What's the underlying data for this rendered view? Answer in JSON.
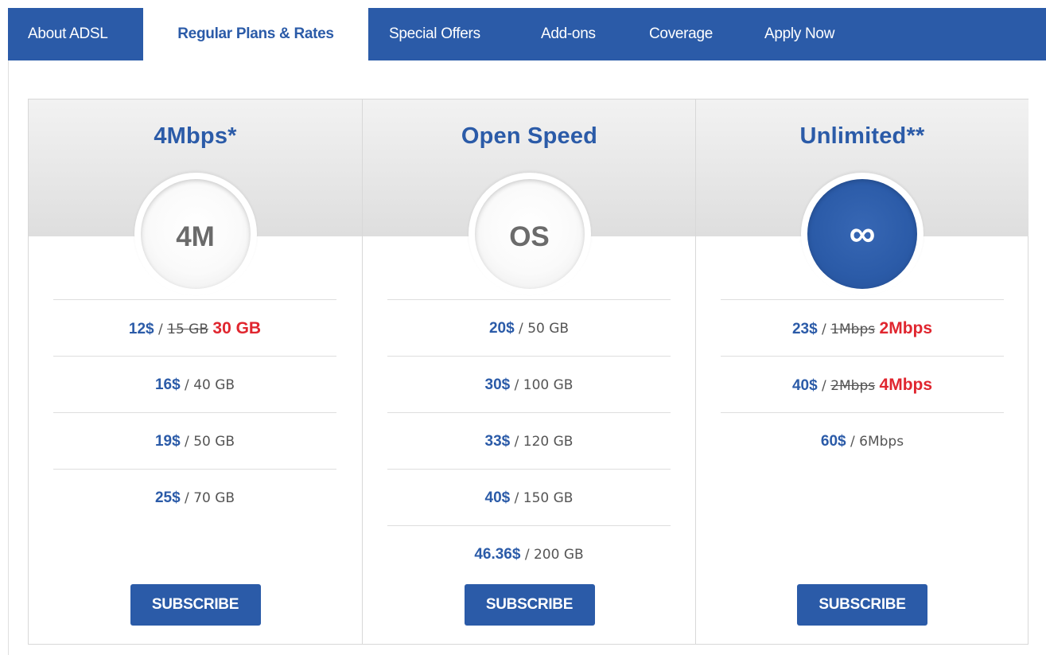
{
  "tabs": [
    {
      "label": "About ADSL",
      "active": false
    },
    {
      "label": "Regular Plans & Rates",
      "active": true
    },
    {
      "label": "Special Offers",
      "active": false
    },
    {
      "label": "Add-ons",
      "active": false
    },
    {
      "label": "Coverage",
      "active": false
    },
    {
      "label": "Apply Now",
      "active": false
    }
  ],
  "colors": {
    "brand": "#2b5ba8",
    "highlight": "#e0262f"
  },
  "plans": [
    {
      "title": "4Mbps*",
      "badge": "4M",
      "rows": [
        {
          "price": "12$",
          "sep": "/",
          "old": "15 GB",
          "value": "30 GB"
        },
        {
          "price": "16$",
          "sep": "/",
          "value": "40 GB"
        },
        {
          "price": "19$",
          "sep": "/",
          "value": "50 GB"
        },
        {
          "price": "25$",
          "sep": "/",
          "value": "70 GB"
        }
      ],
      "button": "SUBSCRIBE"
    },
    {
      "title": "Open Speed",
      "badge": "OS",
      "rows": [
        {
          "price": "20$",
          "sep": "/",
          "value": "50 GB"
        },
        {
          "price": "30$",
          "sep": "/",
          "value": "100 GB"
        },
        {
          "price": "33$",
          "sep": "/",
          "value": "120 GB"
        },
        {
          "price": "40$",
          "sep": "/",
          "value": "150 GB"
        },
        {
          "price": "46.36$",
          "sep": "/",
          "value": "200 GB"
        }
      ],
      "button": "SUBSCRIBE"
    },
    {
      "title": "Unlimited**",
      "badge": "∞",
      "rows": [
        {
          "price": "23$",
          "sep": "/",
          "old": "1Mbps",
          "value": "2Mbps"
        },
        {
          "price": "40$",
          "sep": "/",
          "old": "2Mbps",
          "value": "4Mbps"
        },
        {
          "price": "60$",
          "sep": "/",
          "value": "6Mbps"
        }
      ],
      "button": "SUBSCRIBE"
    }
  ]
}
